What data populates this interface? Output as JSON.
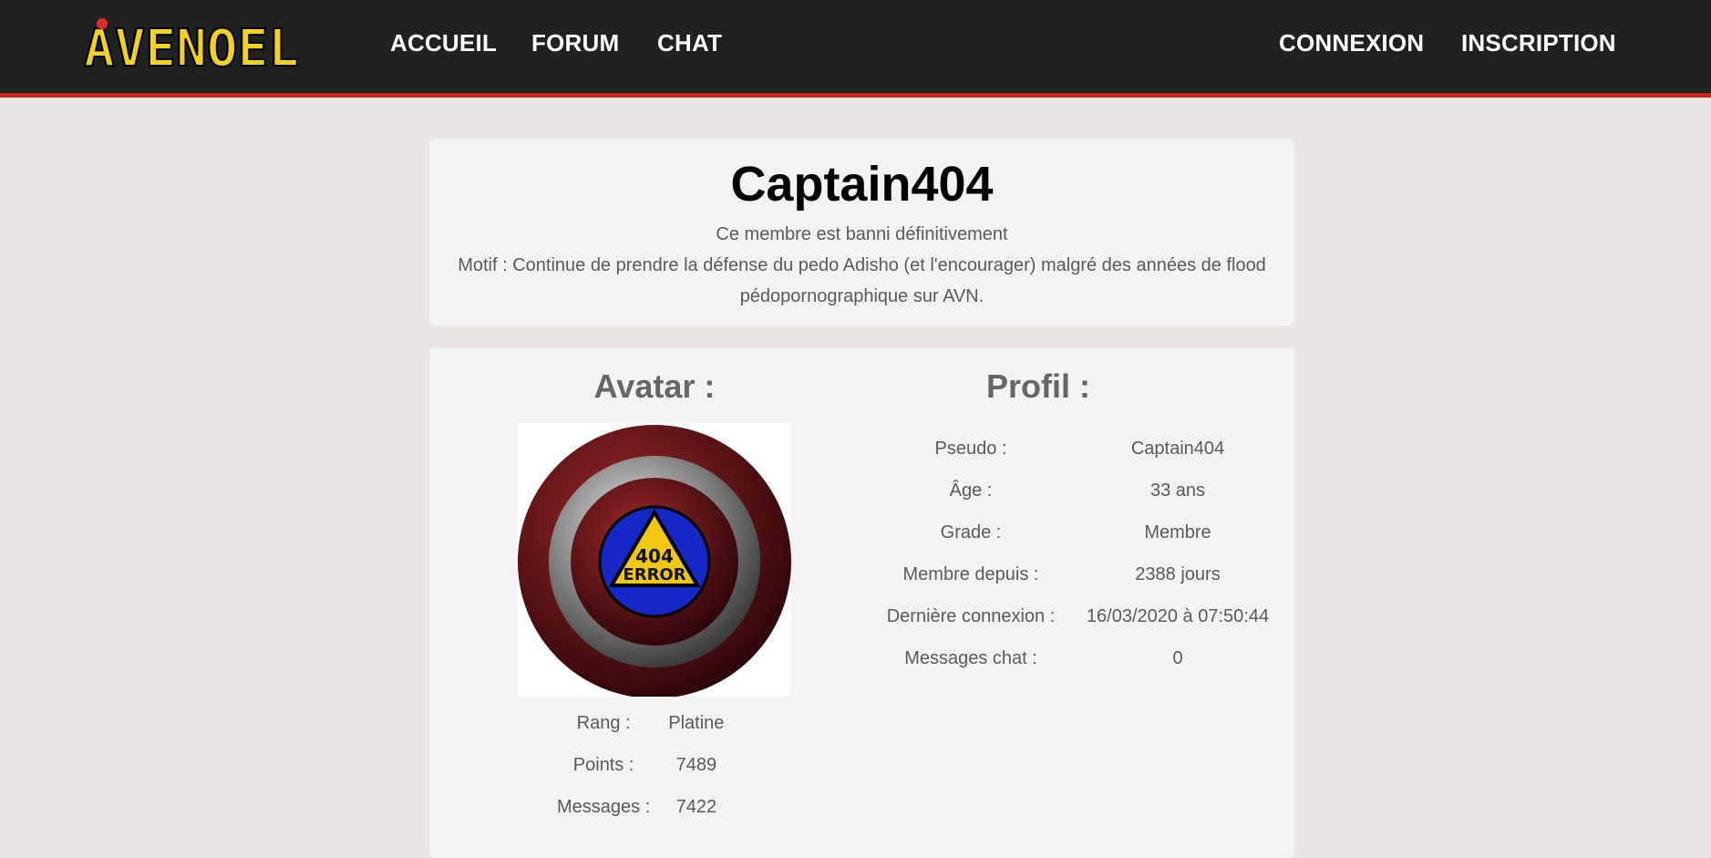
{
  "nav": {
    "logo_text": "AVENOEL",
    "links": [
      "ACCUEIL",
      "FORUM",
      "CHAT"
    ],
    "right_links": [
      "CONNEXION",
      "INSCRIPTION"
    ]
  },
  "ban": {
    "username": "Captain404",
    "status": "Ce membre est banni définitivement",
    "motif": "Motif : Continue de prendre la défense du pedo Adisho (et l'encourager) malgré des années de flood pédopornographique sur AVN."
  },
  "avatar": {
    "heading": "Avatar :",
    "badge_line1": "404",
    "badge_line2": "ERROR",
    "stats": [
      {
        "label": "Rang :",
        "value": "Platine"
      },
      {
        "label": "Points :",
        "value": "7489"
      },
      {
        "label": "Messages :",
        "value": "7422"
      }
    ]
  },
  "profile": {
    "heading": "Profil :",
    "rows": [
      {
        "label": "Pseudo :",
        "value": "Captain404"
      },
      {
        "label": "Âge :",
        "value": "33 ans"
      },
      {
        "label": "Grade :",
        "value": "Membre"
      },
      {
        "label": "Membre depuis :",
        "value": "2388 jours"
      },
      {
        "label": "Dernière connexion :",
        "value": "16/03/2020 à 07:50:44"
      },
      {
        "label": "Messages chat :",
        "value": "0"
      }
    ]
  }
}
